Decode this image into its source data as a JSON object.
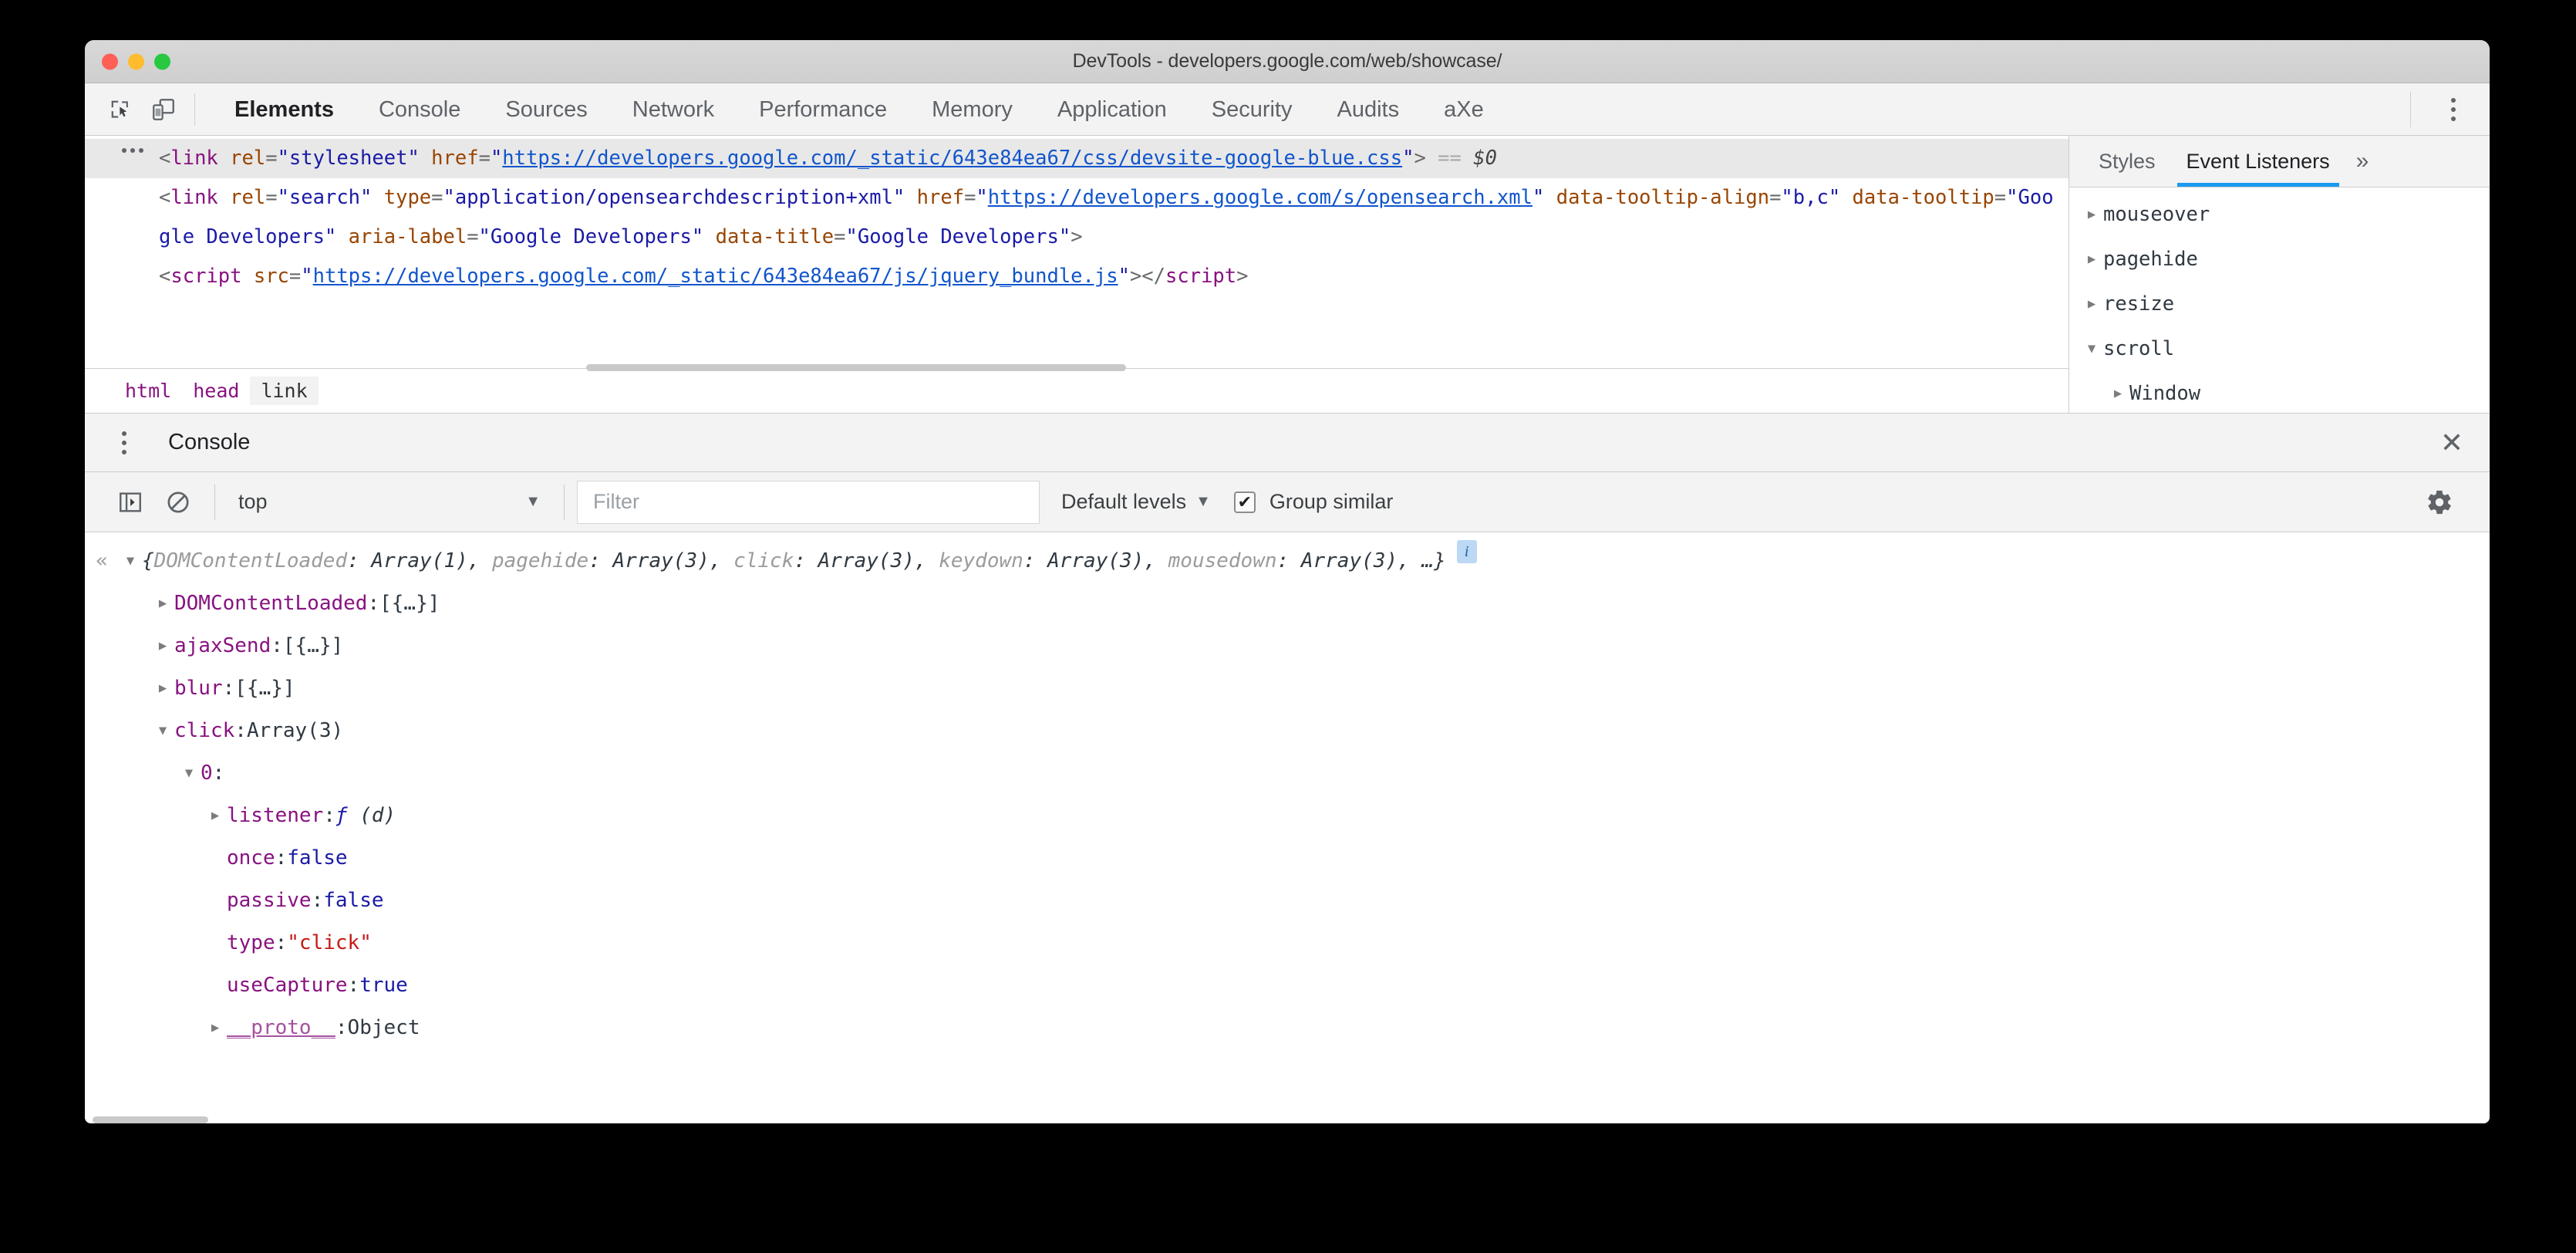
{
  "window": {
    "title": "DevTools - developers.google.com/web/showcase/",
    "traffic_lights": [
      "close",
      "minimize",
      "maximize"
    ],
    "colors": {
      "accent": "#1a9bf0",
      "titlebar": "#d8d8d8",
      "panel": "#f3f3f3"
    }
  },
  "toolbar": {
    "inspect_icon": "inspect-element-icon",
    "device_icon": "device-toolbar-icon",
    "menu_icon": "kebab-menu-icon"
  },
  "tabs": [
    {
      "label": "Elements",
      "active": true
    },
    {
      "label": "Console",
      "active": false
    },
    {
      "label": "Sources",
      "active": false
    },
    {
      "label": "Network",
      "active": false
    },
    {
      "label": "Performance",
      "active": false
    },
    {
      "label": "Memory",
      "active": false
    },
    {
      "label": "Application",
      "active": false
    },
    {
      "label": "Security",
      "active": false
    },
    {
      "label": "Audits",
      "active": false
    },
    {
      "label": "aXe",
      "active": false
    }
  ],
  "dom_tree": {
    "rows": [
      {
        "selected": true,
        "has_ellipsis": true,
        "parts": [
          {
            "t": "punct",
            "s": "<"
          },
          {
            "t": "tag",
            "s": "link"
          },
          {
            "t": "plain",
            "s": " "
          },
          {
            "t": "attr",
            "s": "rel"
          },
          {
            "t": "punct",
            "s": "="
          },
          {
            "t": "val",
            "s": "\"stylesheet\""
          },
          {
            "t": "plain",
            "s": " "
          },
          {
            "t": "attr",
            "s": "href"
          },
          {
            "t": "punct",
            "s": "="
          },
          {
            "t": "val",
            "s": "\""
          },
          {
            "t": "link",
            "s": "https://developers.google.com/_static/643e84ea67/css/devsite-google-blue.css"
          },
          {
            "t": "val",
            "s": "\""
          },
          {
            "t": "punct",
            "s": ">"
          },
          {
            "t": "plain",
            "s": " "
          },
          {
            "t": "eq",
            "s": "=="
          },
          {
            "t": "plain",
            "s": " "
          },
          {
            "t": "ref",
            "s": "$0"
          }
        ]
      },
      {
        "selected": false,
        "has_ellipsis": false,
        "parts": [
          {
            "t": "punct",
            "s": "<"
          },
          {
            "t": "tag",
            "s": "link"
          },
          {
            "t": "plain",
            "s": " "
          },
          {
            "t": "attr",
            "s": "rel"
          },
          {
            "t": "punct",
            "s": "="
          },
          {
            "t": "val",
            "s": "\"search\""
          },
          {
            "t": "plain",
            "s": " "
          },
          {
            "t": "attr",
            "s": "type"
          },
          {
            "t": "punct",
            "s": "="
          },
          {
            "t": "val",
            "s": "\"application/opensearchdescription+xml\""
          },
          {
            "t": "plain",
            "s": " "
          },
          {
            "t": "attr",
            "s": "href"
          },
          {
            "t": "punct",
            "s": "="
          },
          {
            "t": "val",
            "s": "\""
          },
          {
            "t": "link",
            "s": "https://developers.google.com/s/opensearch.xml"
          },
          {
            "t": "val",
            "s": "\""
          },
          {
            "t": "plain",
            "s": " "
          },
          {
            "t": "attr",
            "s": "data-tooltip-align"
          },
          {
            "t": "punct",
            "s": "="
          },
          {
            "t": "val",
            "s": "\"b,c\""
          },
          {
            "t": "plain",
            "s": " "
          },
          {
            "t": "attr",
            "s": "data-tooltip"
          },
          {
            "t": "punct",
            "s": "="
          },
          {
            "t": "val",
            "s": "\"Google Developers\""
          },
          {
            "t": "plain",
            "s": " "
          },
          {
            "t": "attr",
            "s": "aria-label"
          },
          {
            "t": "punct",
            "s": "="
          },
          {
            "t": "val",
            "s": "\"Google Developers\""
          },
          {
            "t": "plain",
            "s": " "
          },
          {
            "t": "attr",
            "s": "data-title"
          },
          {
            "t": "punct",
            "s": "="
          },
          {
            "t": "val",
            "s": "\"Google Developers\""
          },
          {
            "t": "punct",
            "s": ">"
          }
        ]
      },
      {
        "selected": false,
        "has_ellipsis": false,
        "clipped": true,
        "parts": [
          {
            "t": "punct",
            "s": "<"
          },
          {
            "t": "tag",
            "s": "script"
          },
          {
            "t": "plain",
            "s": " "
          },
          {
            "t": "attr",
            "s": "src"
          },
          {
            "t": "punct",
            "s": "="
          },
          {
            "t": "val",
            "s": "\""
          },
          {
            "t": "link",
            "s": "https://developers.google.com/_static/643e84ea67/js/jquery_bundle.js"
          },
          {
            "t": "val",
            "s": "\""
          },
          {
            "t": "punct",
            "s": "></"
          },
          {
            "t": "tag",
            "s": "script"
          },
          {
            "t": "punct",
            "s": ">"
          }
        ]
      }
    ]
  },
  "breadcrumb": [
    {
      "label": "html",
      "active": false
    },
    {
      "label": "head",
      "active": false
    },
    {
      "label": "link",
      "active": true
    }
  ],
  "sidebar": {
    "tabs": [
      {
        "label": "Styles",
        "active": false
      },
      {
        "label": "Event Listeners",
        "active": true
      }
    ],
    "more_icon": "chevron-double-right-icon",
    "listeners": [
      {
        "label": "mouseover",
        "expanded": false,
        "indent": 0
      },
      {
        "label": "pagehide",
        "expanded": false,
        "indent": 0
      },
      {
        "label": "resize",
        "expanded": false,
        "indent": 0
      },
      {
        "label": "scroll",
        "expanded": true,
        "indent": 0
      },
      {
        "label": "Window",
        "expanded": false,
        "indent": 1
      }
    ]
  },
  "drawer": {
    "menu_icon": "kebab-menu-icon",
    "title": "Console",
    "close_icon": "close-icon"
  },
  "console_toolbar": {
    "sidebar_toggle_icon": "console-sidebar-icon",
    "clear_icon": "clear-console-icon",
    "context": "top",
    "context_caret": "▼",
    "filter_placeholder": "Filter",
    "filter_value": "",
    "levels_label": "Default levels",
    "levels_caret": "▼",
    "group_similar_label": "Group similar",
    "group_similar_checked": true,
    "settings_icon": "gear-icon"
  },
  "console_output": {
    "nav_glyph": "«",
    "preview": {
      "open": "{",
      "entries": [
        {
          "key": "DOMContentLoaded",
          "value": "Array(1)"
        },
        {
          "key": "pagehide",
          "value": "Array(3)"
        },
        {
          "key": "click",
          "value": "Array(3)"
        },
        {
          "key": "keydown",
          "value": "Array(3)"
        },
        {
          "key": "mousedown",
          "value": "Array(3)"
        }
      ],
      "tail": ", …}",
      "info_badge": "i"
    },
    "rows": [
      {
        "indent": 1,
        "arrow": "collapsed",
        "name": "DOMContentLoaded",
        "sep": ": ",
        "value": "[{…}]",
        "vtype": "obj"
      },
      {
        "indent": 1,
        "arrow": "collapsed",
        "name": "ajaxSend",
        "sep": ": ",
        "value": "[{…}]",
        "vtype": "obj"
      },
      {
        "indent": 1,
        "arrow": "collapsed",
        "name": "blur",
        "sep": ": ",
        "value": "[{…}]",
        "vtype": "obj"
      },
      {
        "indent": 1,
        "arrow": "expanded",
        "name": "click",
        "sep": ": ",
        "value": "Array(3)",
        "vtype": "obj"
      },
      {
        "indent": 2,
        "arrow": "expanded",
        "name": "0",
        "sep": ":",
        "value": "",
        "vtype": "num"
      },
      {
        "indent": 3,
        "arrow": "collapsed",
        "name": "listener",
        "sep": ": ",
        "value": "ƒ (d)",
        "vtype": "func"
      },
      {
        "indent": 3,
        "arrow": "none",
        "name": "once",
        "sep": ": ",
        "value": "false",
        "vtype": "bool"
      },
      {
        "indent": 3,
        "arrow": "none",
        "name": "passive",
        "sep": ": ",
        "value": "false",
        "vtype": "bool"
      },
      {
        "indent": 3,
        "arrow": "none",
        "name": "type",
        "sep": ": ",
        "value": "\"click\"",
        "vtype": "str"
      },
      {
        "indent": 3,
        "arrow": "none",
        "name": "useCapture",
        "sep": ": ",
        "value": "true",
        "vtype": "bool"
      },
      {
        "indent": 3,
        "arrow": "collapsed",
        "name": "__proto__",
        "sep": ": ",
        "value": "Object",
        "vtype": "obj",
        "proto": true
      }
    ]
  }
}
